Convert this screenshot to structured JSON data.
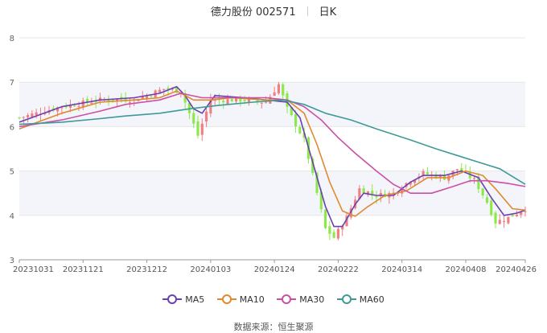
{
  "header": {
    "title": "德力股份 002571",
    "period": "日K"
  },
  "source": "数据来源：恒生聚源",
  "colors": {
    "up": "#f07f7f",
    "down": "#8de84a",
    "band": "#f3f5fb"
  },
  "chart_data": {
    "type": "line",
    "ylim": [
      3,
      8
    ],
    "yticks": [
      "3",
      "4",
      "5",
      "6",
      "7",
      "8"
    ],
    "xtick_labels": [
      "20231031",
      "20231121",
      "20231212",
      "20240103",
      "20240124",
      "20240222",
      "20240314",
      "20240408",
      "20240426"
    ],
    "n_days": 120,
    "xtick_index": [
      0,
      15,
      30,
      45,
      60,
      75,
      90,
      105,
      119
    ],
    "candles_key": [
      [
        0,
        6.2
      ],
      [
        10,
        6.45
      ],
      [
        19,
        6.6
      ],
      [
        23,
        6.62
      ],
      [
        27,
        6.6
      ],
      [
        34,
        6.85
      ],
      [
        38,
        6.8
      ],
      [
        40,
        6.3
      ],
      [
        42,
        5.8
      ],
      [
        45,
        6.6
      ],
      [
        52,
        6.6
      ],
      [
        58,
        6.55
      ],
      [
        61,
        6.95
      ],
      [
        63,
        6.4
      ],
      [
        67,
        5.7
      ],
      [
        70,
        4.5
      ],
      [
        72,
        3.7
      ],
      [
        74,
        3.5
      ],
      [
        77,
        3.95
      ],
      [
        80,
        4.6
      ],
      [
        84,
        4.45
      ],
      [
        88,
        4.5
      ],
      [
        92,
        4.8
      ],
      [
        95,
        4.95
      ],
      [
        100,
        4.85
      ],
      [
        103,
        5.05
      ],
      [
        107,
        4.8
      ],
      [
        110,
        4.3
      ],
      [
        112,
        3.85
      ],
      [
        115,
        3.95
      ],
      [
        119,
        4.15
      ]
    ],
    "series": [
      {
        "name": "MA5",
        "color": "#6a3fb0",
        "points": [
          [
            0,
            6.1
          ],
          [
            10,
            6.45
          ],
          [
            19,
            6.6
          ],
          [
            27,
            6.65
          ],
          [
            33,
            6.75
          ],
          [
            37,
            6.9
          ],
          [
            39,
            6.7
          ],
          [
            41,
            6.4
          ],
          [
            43,
            6.3
          ],
          [
            46,
            6.7
          ],
          [
            53,
            6.65
          ],
          [
            58,
            6.6
          ],
          [
            63,
            6.55
          ],
          [
            66,
            6.2
          ],
          [
            69,
            5.2
          ],
          [
            72,
            4.2
          ],
          [
            74,
            3.75
          ],
          [
            76,
            3.75
          ],
          [
            79,
            4.25
          ],
          [
            81,
            4.5
          ],
          [
            84,
            4.45
          ],
          [
            88,
            4.45
          ],
          [
            92,
            4.75
          ],
          [
            95,
            4.9
          ],
          [
            100,
            4.9
          ],
          [
            104,
            5.0
          ],
          [
            108,
            4.85
          ],
          [
            111,
            4.4
          ],
          [
            114,
            4.0
          ],
          [
            117,
            4.05
          ],
          [
            119,
            4.12
          ]
        ]
      },
      {
        "name": "MA10",
        "color": "#e0892e",
        "points": [
          [
            0,
            5.95
          ],
          [
            10,
            6.3
          ],
          [
            19,
            6.55
          ],
          [
            27,
            6.6
          ],
          [
            33,
            6.65
          ],
          [
            37,
            6.8
          ],
          [
            41,
            6.6
          ],
          [
            45,
            6.6
          ],
          [
            50,
            6.65
          ],
          [
            58,
            6.6
          ],
          [
            63,
            6.6
          ],
          [
            67,
            6.3
          ],
          [
            70,
            5.6
          ],
          [
            73,
            4.75
          ],
          [
            76,
            4.1
          ],
          [
            79,
            3.98
          ],
          [
            82,
            4.2
          ],
          [
            86,
            4.45
          ],
          [
            91,
            4.55
          ],
          [
            96,
            4.85
          ],
          [
            101,
            4.85
          ],
          [
            105,
            5.0
          ],
          [
            109,
            4.9
          ],
          [
            112,
            4.6
          ],
          [
            116,
            4.15
          ],
          [
            119,
            4.12
          ]
        ]
      },
      {
        "name": "MA30",
        "color": "#cc4fa6",
        "points": [
          [
            0,
            6.0
          ],
          [
            10,
            6.15
          ],
          [
            19,
            6.35
          ],
          [
            25,
            6.5
          ],
          [
            33,
            6.6
          ],
          [
            38,
            6.75
          ],
          [
            43,
            6.65
          ],
          [
            50,
            6.65
          ],
          [
            58,
            6.65
          ],
          [
            63,
            6.6
          ],
          [
            67,
            6.45
          ],
          [
            71,
            6.15
          ],
          [
            75,
            5.75
          ],
          [
            79,
            5.4
          ],
          [
            84,
            5.0
          ],
          [
            88,
            4.7
          ],
          [
            92,
            4.5
          ],
          [
            97,
            4.5
          ],
          [
            102,
            4.65
          ],
          [
            106,
            4.78
          ],
          [
            110,
            4.78
          ],
          [
            115,
            4.72
          ],
          [
            119,
            4.65
          ]
        ]
      },
      {
        "name": "MA60",
        "color": "#3d9a97",
        "points": [
          [
            0,
            6.05
          ],
          [
            10,
            6.1
          ],
          [
            19,
            6.18
          ],
          [
            25,
            6.24
          ],
          [
            33,
            6.3
          ],
          [
            40,
            6.4
          ],
          [
            47,
            6.48
          ],
          [
            55,
            6.55
          ],
          [
            62,
            6.6
          ],
          [
            67,
            6.5
          ],
          [
            72,
            6.3
          ],
          [
            78,
            6.15
          ],
          [
            84,
            5.95
          ],
          [
            92,
            5.7
          ],
          [
            98,
            5.5
          ],
          [
            103,
            5.35
          ],
          [
            108,
            5.2
          ],
          [
            113,
            5.05
          ],
          [
            119,
            4.7
          ]
        ]
      }
    ]
  }
}
